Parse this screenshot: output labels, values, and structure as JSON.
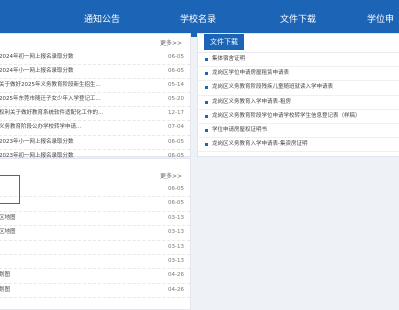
{
  "nav": {
    "items": [
      "通知公告",
      "学校名录",
      "文件下载",
      "学位申"
    ]
  },
  "top_left_panel": {
    "more": "更多>>",
    "items": [
      {
        "title": "2024年初一网上报名录取分数",
        "date": "06-05"
      },
      {
        "title": "2024年小一网上报名录取分数",
        "date": "06-05"
      },
      {
        "title": "关于做好2025年义务教育阶段新生招生...",
        "date": "05-14"
      },
      {
        "title": "2025年东莞市随迁子女少年入学登记工...",
        "date": "05-20"
      },
      {
        "title": "权利关于做好教育系统软件适配化工作的...",
        "date": "12-17"
      },
      {
        "title": "义务教育阶段公办学校转学申请...",
        "date": "07-04"
      },
      {
        "title": "2023年小一网上报名录取分数",
        "date": "06-05"
      },
      {
        "title": "2023年初一网上报名录取分数",
        "date": "06-05"
      }
    ]
  },
  "file_download_panel": {
    "title": "文件下载",
    "items": [
      "集体宿舍证明",
      "龙岗区学位申请房屋租赁申请表",
      "龙岗区义务教育阶段残疾儿童随班就读入学申请表",
      "龙岗区义务教育入学申请表-租房",
      "龙岗区义务教育阶段学位申请学校转学生信息登记表（样稿）",
      "学位申请房屋权证明书",
      "龙岗区义务教育入学申请表-集资房证明"
    ]
  },
  "bottom_left_panel": {
    "more": "更多>>",
    "items": [
      {
        "title": "",
        "date": "06-05"
      },
      {
        "title": "",
        "date": "06-05"
      },
      {
        "title": "区地图",
        "date": "03-13"
      },
      {
        "title": "区地图",
        "date": "03-13"
      },
      {
        "title": "",
        "date": "03-13"
      },
      {
        "title": "",
        "date": "03-13"
      },
      {
        "title": "划图",
        "date": "04-26"
      },
      {
        "title": "划图",
        "date": "04-26"
      }
    ]
  }
}
